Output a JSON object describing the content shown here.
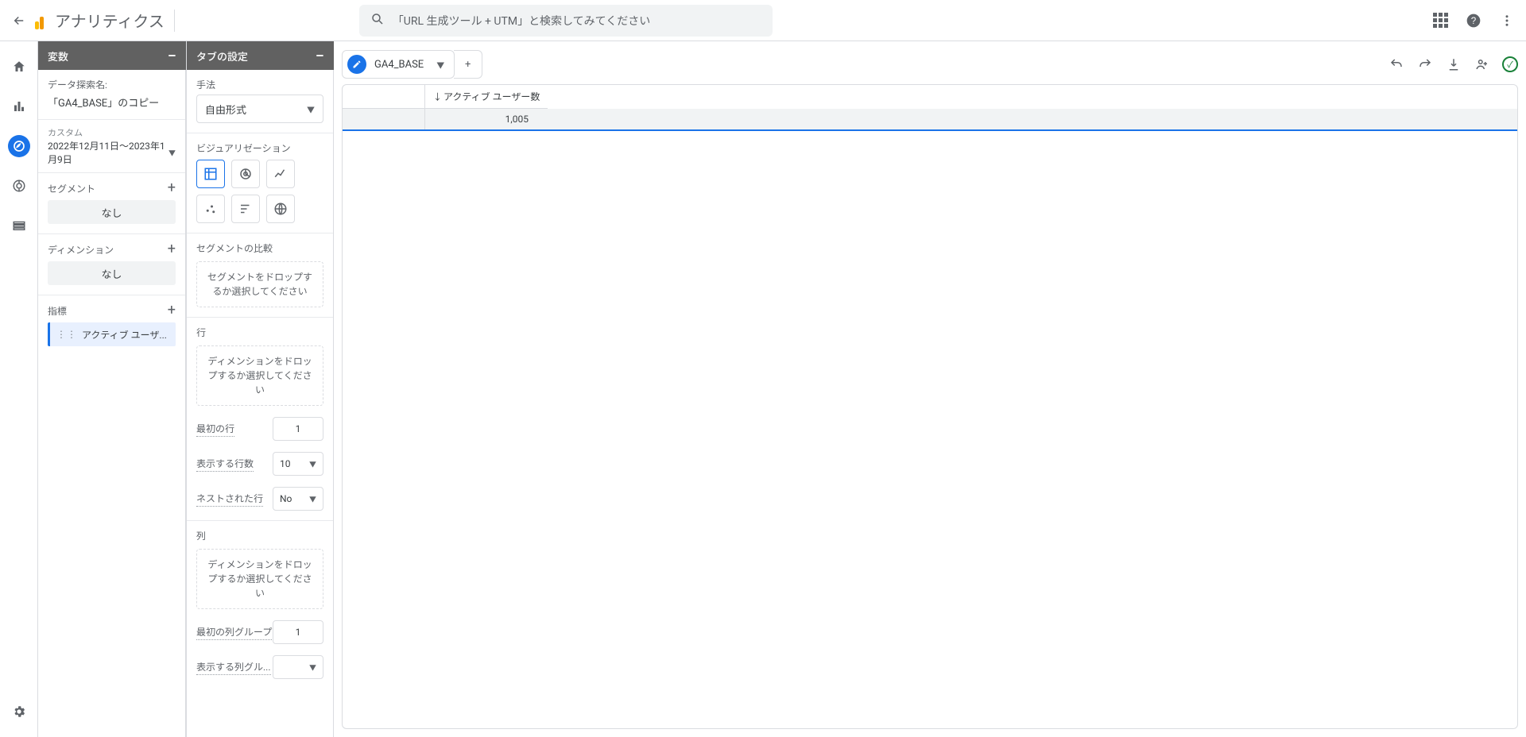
{
  "header": {
    "app_title": "アナリティクス",
    "search_placeholder": "「URL 生成ツール + UTM」と検索してみてください"
  },
  "variables_panel": {
    "title": "変数",
    "exploration_name_label": "データ探索名:",
    "exploration_name_value": "「GA4_BASE」のコピー",
    "custom_label": "カスタム",
    "date_range": "2022年12月11日～2023年1月9日",
    "segments_label": "セグメント",
    "segments_none": "なし",
    "dimensions_label": "ディメンション",
    "dimensions_none": "なし",
    "metrics_label": "指標",
    "metric_chip": "アクティブ ユーザ..."
  },
  "tab_panel": {
    "title": "タブの設定",
    "technique_label": "手法",
    "technique_value": "自由形式",
    "visualization_label": "ビジュアリゼーション",
    "seg_compare_label": "セグメントの比較",
    "seg_compare_drop": "セグメントをドロップするか選択してください",
    "rows_label": "行",
    "rows_drop": "ディメンションをドロップするか選択してください",
    "first_row_label": "最初の行",
    "first_row_value": "1",
    "show_rows_label": "表示する行数",
    "show_rows_value": "10",
    "nested_rows_label": "ネストされた行",
    "nested_rows_value": "No",
    "cols_label": "列",
    "cols_drop": "ディメンションをドロップするか選択してください",
    "first_col_group_label": "最初の列グループ",
    "first_col_group_value": "1",
    "show_col_groups_label": "表示する列グル..."
  },
  "canvas": {
    "tab_name": "GA4_BASE",
    "metric_header": "アクティブ ユーザー数",
    "metric_value": "1,005"
  }
}
